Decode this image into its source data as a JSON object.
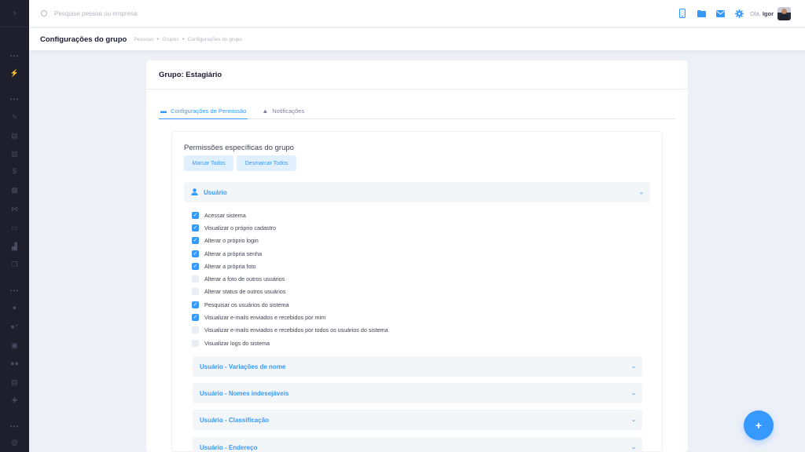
{
  "search": {
    "placeholder": "Pesquise pessoa ou empresa"
  },
  "user": {
    "greeting": "Olá,",
    "name": "Igor"
  },
  "subheader": {
    "title": "Configurações do grupo",
    "breadcrumb": [
      "Pessoas",
      "Grupos",
      "Configurações do grupo"
    ]
  },
  "card": {
    "title": "Grupo: Estagiário",
    "tabs": [
      {
        "label": "Configurações de Permissão",
        "active": true
      },
      {
        "label": "Notificações",
        "active": false
      }
    ]
  },
  "permissions": {
    "title": "Permissões específicas do grupo",
    "mark_all": "Marcar Todos",
    "unmark_all": "Desmarcar Todos",
    "section": "Usuário",
    "items": [
      {
        "label": "Acessar sistema",
        "checked": true
      },
      {
        "label": "Visualizar o próprio cadastro",
        "checked": true
      },
      {
        "label": "Alterar o próprio login",
        "checked": true
      },
      {
        "label": "Alterar a própria senha",
        "checked": true
      },
      {
        "label": "Alterar a própria foto",
        "checked": true
      },
      {
        "label": "Alterar a foto de outros usuários",
        "checked": false
      },
      {
        "label": "Alterar status de outros usuários",
        "checked": false
      },
      {
        "label": "Pesquisar os usuários do sistema",
        "checked": true
      },
      {
        "label": "Visualizar e-mails enviados e recebidos por mim",
        "checked": true
      },
      {
        "label": "Visualizar e-mails enviados e recebidos por todos os usuários do sistema",
        "checked": false
      },
      {
        "label": "Visualizar logs do sistema",
        "checked": false
      }
    ],
    "subsections": [
      "Usuário - Variações de nome",
      "Usuário - Nomes indesejáveis",
      "Usuário - Classificação",
      "Usuário - Endereço"
    ]
  },
  "colors": {
    "accent": "#3699ff",
    "sidebar": "#1e1e2d"
  },
  "icons": {
    "sidebar": [
      "menu-toggle-icon",
      "lightning-icon",
      "wrench-icon",
      "document-icon",
      "file-icon",
      "dollar-icon",
      "calendar-icon",
      "network-icon",
      "folder-icon",
      "chart-icon",
      "copy-icon",
      "user-icon",
      "user-plus-icon",
      "briefcase-icon",
      "users-icon",
      "list-icon",
      "gift-icon",
      "at-icon"
    ],
    "topbar": [
      "phone-icon",
      "folder-icon",
      "mail-icon",
      "gear-icon"
    ]
  }
}
